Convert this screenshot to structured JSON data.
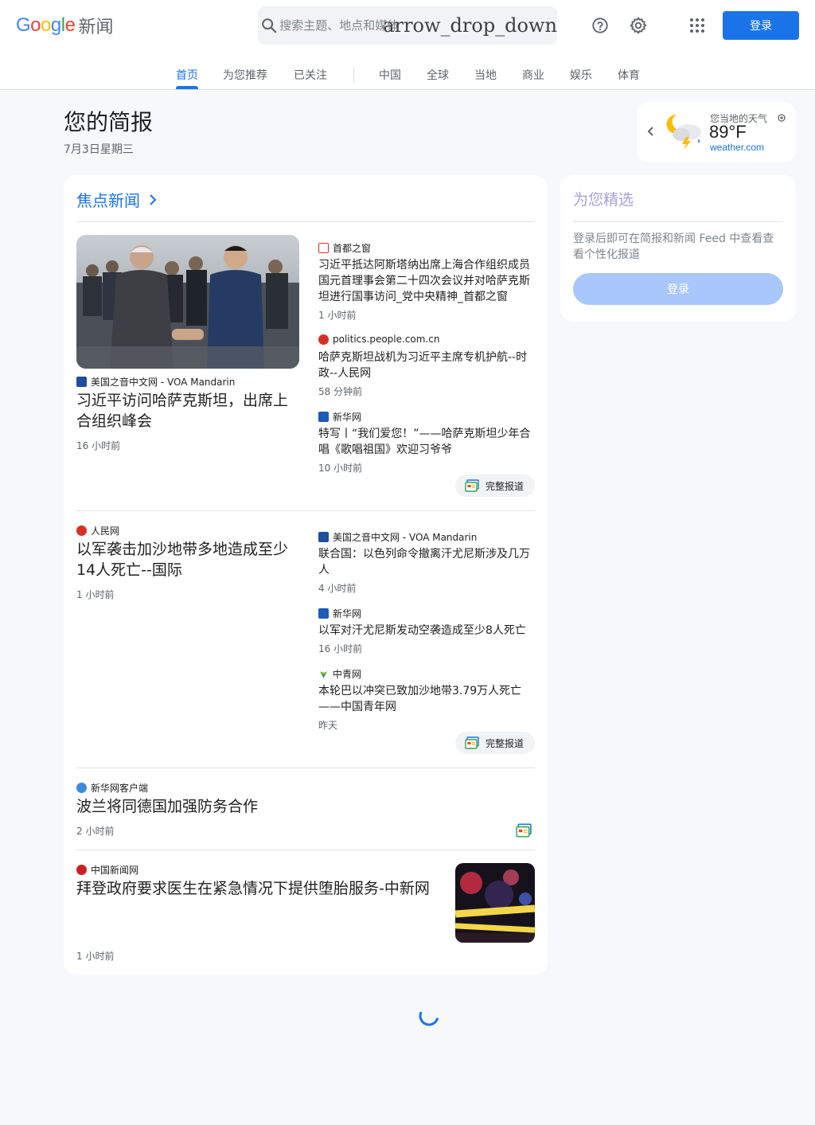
{
  "header": {
    "logo_text": "Google",
    "logo_product": "新闻",
    "search_placeholder": "搜索主题、地点和媒体",
    "search_dropdown_text": "arrow_drop_down",
    "login_label": "登录"
  },
  "tabs": [
    {
      "label": "首页",
      "active": true
    },
    {
      "label": "为您推荐"
    },
    {
      "label": "已关注"
    },
    {
      "label": "中国"
    },
    {
      "label": "全球"
    },
    {
      "label": "当地"
    },
    {
      "label": "商业"
    },
    {
      "label": "娱乐"
    },
    {
      "label": "体育"
    }
  ],
  "briefing": {
    "title": "您的简报",
    "date": "7月3日星期三"
  },
  "weather": {
    "label": "您当地的天气",
    "temp": "89°F",
    "source": "weather.com"
  },
  "top_stories": {
    "title": "焦点新闻",
    "full_coverage_label": "完整报道",
    "cluster1": {
      "main": {
        "source": "美国之音中文网 - VOA Mandarin",
        "headline": "习近平访问哈萨克斯坦，出席上合组织峰会",
        "time": "16 小时前"
      },
      "related": [
        {
          "source": "首都之窗",
          "headline": "习近平抵达阿斯塔纳出席上海合作组织成员国元首理事会第二十四次会议并对哈萨克斯坦进行国事访问_党中央精神_首都之窗",
          "time": "1 小时前"
        },
        {
          "source": "politics.people.com.cn",
          "headline": "哈萨克斯坦战机为习近平主席专机护航--时政--人民网",
          "time": "58 分钟前"
        },
        {
          "source": "新华网",
          "headline": "特写丨“我们爱您！”——哈萨克斯坦少年合唱《歌唱祖国》欢迎习爷爷",
          "time": "10 小时前"
        }
      ]
    },
    "cluster2": {
      "main": {
        "source": "人民网",
        "headline": "以军袭击加沙地带多地造成至少14人死亡--国际",
        "time": "1 小时前"
      },
      "related": [
        {
          "source": "美国之音中文网 - VOA Mandarin",
          "headline": "联合国：以色列命令撤离汗尤尼斯涉及几万人",
          "time": "4 小时前"
        },
        {
          "source": "新华网",
          "headline": "以军对汗尤尼斯发动空袭造成至少8人死亡",
          "time": "16 小时前"
        },
        {
          "source": "中青网",
          "headline": "本轮巴以冲突已致加沙地带3.79万人死亡——中国青年网",
          "time": "昨天"
        }
      ]
    },
    "story3": {
      "source": "新华网客户端",
      "headline": "波兰将同德国加强防务合作",
      "time": "2 小时前"
    },
    "story4": {
      "source": "中国新闻网",
      "headline": "拜登政府要求医生在紧急情况下提供堕胎服务-中新网",
      "time": "1 小时前"
    }
  },
  "picks": {
    "title": "为您精选",
    "text": "登录后即可在简报和新闻 Feed 中查看查看个性化报道",
    "button": "登录"
  },
  "colors": {
    "accent": "#1a73e8",
    "background": "#f6f8fc"
  }
}
